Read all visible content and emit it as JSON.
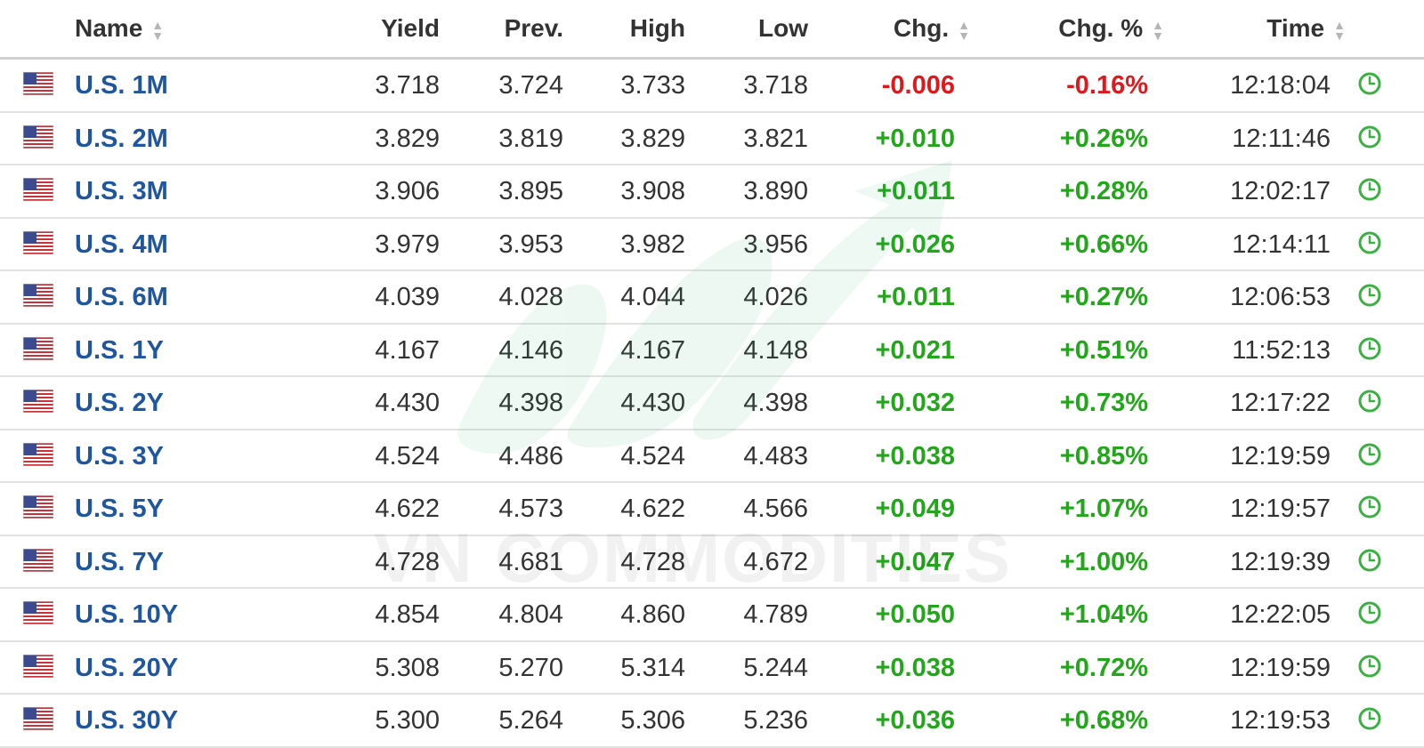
{
  "header": {
    "name": "Name",
    "yield": "Yield",
    "prev": "Prev.",
    "high": "High",
    "low": "Low",
    "chg": "Chg.",
    "chg_pct": "Chg. %",
    "time": "Time"
  },
  "colors": {
    "negative": "#e0181b",
    "positive": "#22a61a",
    "link": "#1e56a0",
    "clock": "#3cb043"
  },
  "icons": {
    "flag": "us-flag-icon",
    "clock": "clock-icon",
    "sort": "sort-arrows-icon"
  },
  "watermark": {
    "text": "VN COMMODITIES"
  },
  "rows": [
    {
      "name": "U.S. 1M",
      "yield": "3.718",
      "prev": "3.724",
      "high": "3.733",
      "low": "3.718",
      "chg": "-0.006",
      "chg_pct": "-0.16%",
      "time": "12:18:04",
      "direction": "neg"
    },
    {
      "name": "U.S. 2M",
      "yield": "3.829",
      "prev": "3.819",
      "high": "3.829",
      "low": "3.821",
      "chg": "+0.010",
      "chg_pct": "+0.26%",
      "time": "12:11:46",
      "direction": "pos"
    },
    {
      "name": "U.S. 3M",
      "yield": "3.906",
      "prev": "3.895",
      "high": "3.908",
      "low": "3.890",
      "chg": "+0.011",
      "chg_pct": "+0.28%",
      "time": "12:02:17",
      "direction": "pos"
    },
    {
      "name": "U.S. 4M",
      "yield": "3.979",
      "prev": "3.953",
      "high": "3.982",
      "low": "3.956",
      "chg": "+0.026",
      "chg_pct": "+0.66%",
      "time": "12:14:11",
      "direction": "pos"
    },
    {
      "name": "U.S. 6M",
      "yield": "4.039",
      "prev": "4.028",
      "high": "4.044",
      "low": "4.026",
      "chg": "+0.011",
      "chg_pct": "+0.27%",
      "time": "12:06:53",
      "direction": "pos"
    },
    {
      "name": "U.S. 1Y",
      "yield": "4.167",
      "prev": "4.146",
      "high": "4.167",
      "low": "4.148",
      "chg": "+0.021",
      "chg_pct": "+0.51%",
      "time": "11:52:13",
      "direction": "pos"
    },
    {
      "name": "U.S. 2Y",
      "yield": "4.430",
      "prev": "4.398",
      "high": "4.430",
      "low": "4.398",
      "chg": "+0.032",
      "chg_pct": "+0.73%",
      "time": "12:17:22",
      "direction": "pos"
    },
    {
      "name": "U.S. 3Y",
      "yield": "4.524",
      "prev": "4.486",
      "high": "4.524",
      "low": "4.483",
      "chg": "+0.038",
      "chg_pct": "+0.85%",
      "time": "12:19:59",
      "direction": "pos"
    },
    {
      "name": "U.S. 5Y",
      "yield": "4.622",
      "prev": "4.573",
      "high": "4.622",
      "low": "4.566",
      "chg": "+0.049",
      "chg_pct": "+1.07%",
      "time": "12:19:57",
      "direction": "pos"
    },
    {
      "name": "U.S. 7Y",
      "yield": "4.728",
      "prev": "4.681",
      "high": "4.728",
      "low": "4.672",
      "chg": "+0.047",
      "chg_pct": "+1.00%",
      "time": "12:19:39",
      "direction": "pos"
    },
    {
      "name": "U.S. 10Y",
      "yield": "4.854",
      "prev": "4.804",
      "high": "4.860",
      "low": "4.789",
      "chg": "+0.050",
      "chg_pct": "+1.04%",
      "time": "12:22:05",
      "direction": "pos"
    },
    {
      "name": "U.S. 20Y",
      "yield": "5.308",
      "prev": "5.270",
      "high": "5.314",
      "low": "5.244",
      "chg": "+0.038",
      "chg_pct": "+0.72%",
      "time": "12:19:59",
      "direction": "pos"
    },
    {
      "name": "U.S. 30Y",
      "yield": "5.300",
      "prev": "5.264",
      "high": "5.306",
      "low": "5.236",
      "chg": "+0.036",
      "chg_pct": "+0.68%",
      "time": "12:19:53",
      "direction": "pos"
    }
  ]
}
